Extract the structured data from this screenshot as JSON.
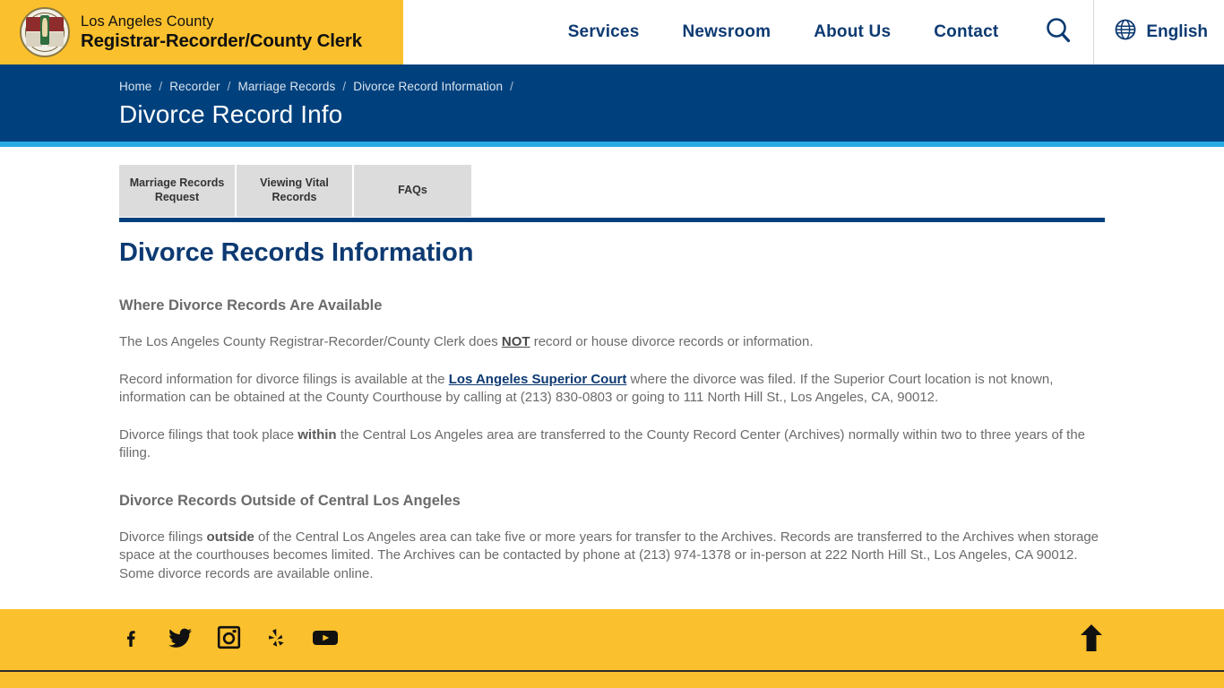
{
  "header": {
    "brand": {
      "logo_icon": "la-county-seal-icon",
      "line1": "Los Angeles County",
      "line2": "Registrar-Recorder/County Clerk"
    },
    "nav": [
      {
        "label": "Services"
      },
      {
        "label": "Newsroom"
      },
      {
        "label": "About Us"
      },
      {
        "label": "Contact"
      }
    ],
    "search_icon": "search-icon",
    "language": {
      "icon": "globe-icon",
      "label": "English"
    },
    "brand_bg": "#fbc02d",
    "nav_color": "#0d3a72"
  },
  "breadcrumb": {
    "items": [
      {
        "label": "Home"
      },
      {
        "label": "Recorder"
      },
      {
        "label": "Marriage Records"
      },
      {
        "label": "Divorce Record Information"
      }
    ],
    "separator": "/",
    "trailing_separator": "/",
    "page_title": "Divorce Record Info",
    "bg": "#00417d",
    "accent_strip": "#29ABE2"
  },
  "tabs": [
    {
      "label": "Marriage Records Request"
    },
    {
      "label": "Viewing Vital Records"
    },
    {
      "label": "FAQs"
    }
  ],
  "main": {
    "heading": "Divorce Records Information",
    "heading_color": "#0d3a72",
    "sections": [
      {
        "subheading": "Where Divorce Records Are Available",
        "paragraphs": [
          {
            "parts": [
              {
                "text": "The Los Angeles County Registrar-Recorder/County Clerk does ",
                "style": "normal"
              },
              {
                "text": "NOT",
                "style": "bold-underline"
              },
              {
                "text": " record or house divorce records or information.",
                "style": "normal"
              }
            ]
          },
          {
            "parts": [
              {
                "text": "Record information for divorce filings is available at the ",
                "style": "normal"
              },
              {
                "text": "Los Angeles Superior Court",
                "style": "link"
              },
              {
                "text": " where the divorce was filed. If the Superior Court location is not known, information can be obtained at the County Courthouse by calling at (213) 830-0803 or going to 111 North Hill St., Los Angeles, CA, 90012.",
                "style": "normal"
              }
            ]
          },
          {
            "parts": [
              {
                "text": "Divorce filings that took place ",
                "style": "normal"
              },
              {
                "text": "within",
                "style": "bold"
              },
              {
                "text": " the Central Los Angeles area are transferred to the County Record Center (Archives) normally within two to three years of the filing.",
                "style": "normal"
              }
            ]
          }
        ]
      },
      {
        "subheading": "Divorce Records Outside of Central Los Angeles",
        "paragraphs": [
          {
            "parts": [
              {
                "text": "Divorce filings ",
                "style": "normal"
              },
              {
                "text": "outside",
                "style": "bold"
              },
              {
                "text": " of the Central Los Angeles area can take five or more years for transfer to the Archives. Records are transferred to the Archives when storage space at the courthouses becomes limited. The Archives can be contacted by phone at (213) 974-1378 or in-person at 222 North Hill St., Los Angeles, CA 90012. Some divorce records are available online.",
                "style": "normal"
              }
            ]
          }
        ]
      }
    ]
  },
  "footer": {
    "bg": "#fbc02d",
    "social_links": [
      {
        "icon": "facebook-icon",
        "name": "Facebook"
      },
      {
        "icon": "twitter-icon",
        "name": "Twitter"
      },
      {
        "icon": "instagram-icon",
        "name": "Instagram"
      },
      {
        "icon": "yelp-icon",
        "name": "Yelp"
      },
      {
        "icon": "youtube-icon",
        "name": "YouTube"
      }
    ],
    "back_to_top_icon": "arrow-up-icon"
  }
}
